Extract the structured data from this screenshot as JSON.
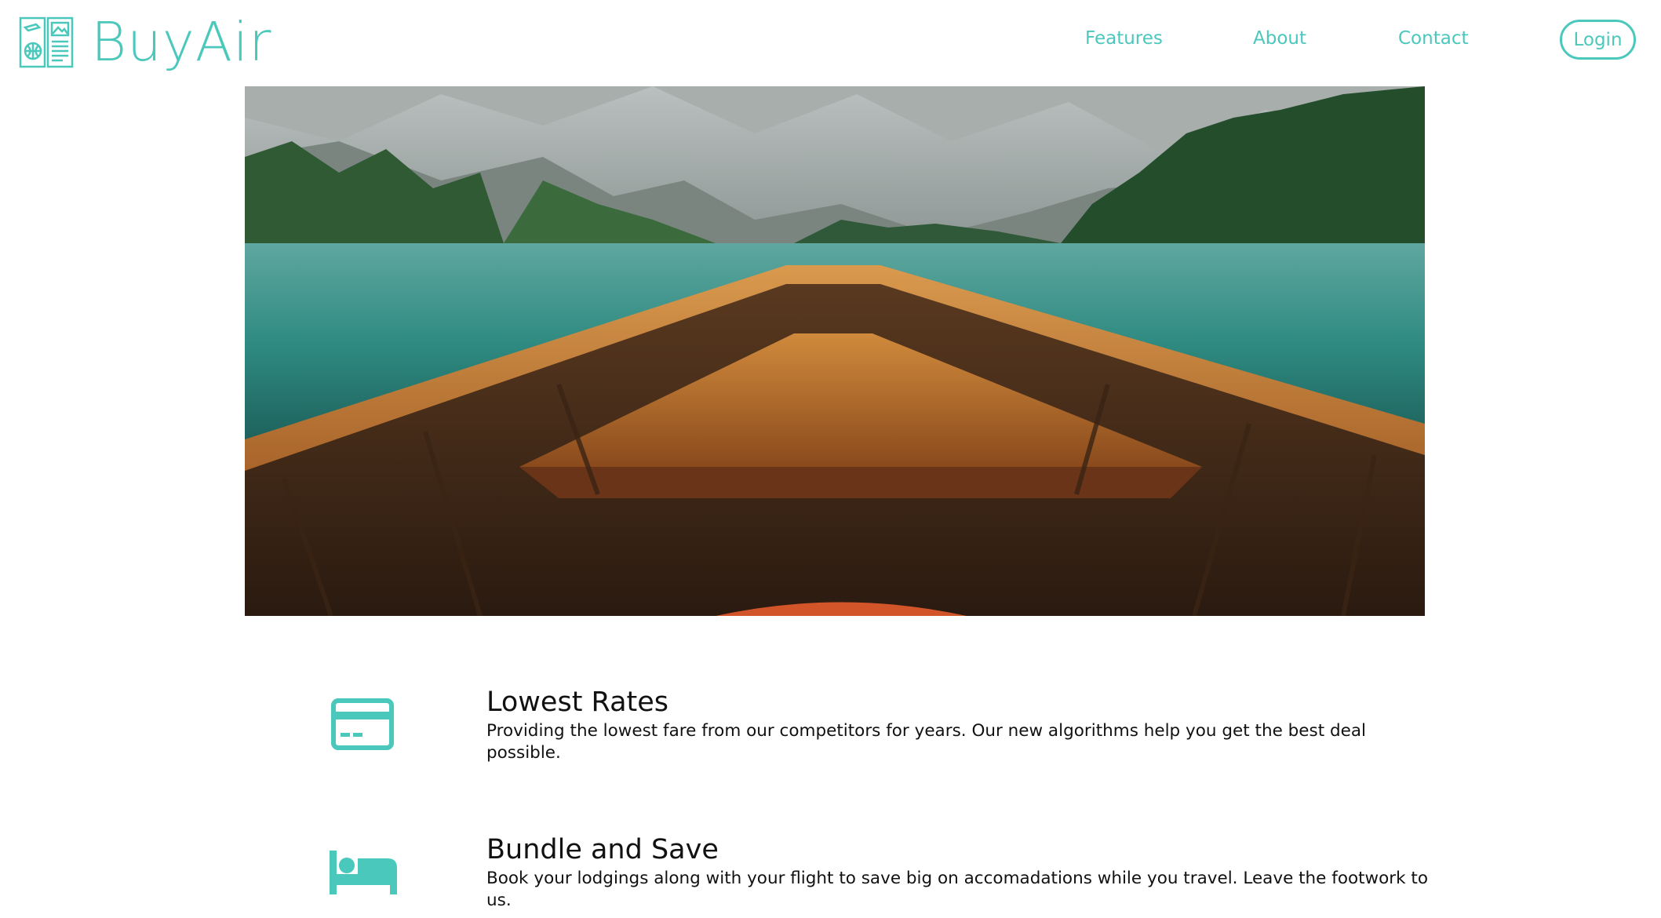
{
  "header": {
    "brand_name": "BuyAir",
    "logo_icon": "travel-brochure-icon",
    "nav": {
      "features_label": "Features",
      "about_label": "About",
      "contact_label": "Contact"
    },
    "login_label": "Login"
  },
  "hero": {
    "image": "boat-on-mountain-lake-photo"
  },
  "features": [
    {
      "icon": "credit-card-icon",
      "title": "Lowest Rates",
      "description": "Providing the lowest fare from our competitors for years. Our new algorithms help you get the best deal possible."
    },
    {
      "icon": "bed-icon",
      "title": "Bundle and Save",
      "description": "Book your lodgings along with your flight to save big on accomadations while you travel. Leave the footwork to us."
    }
  ],
  "colors": {
    "accent": "#4bc8bc",
    "text": "#111111",
    "background": "#ffffff"
  }
}
